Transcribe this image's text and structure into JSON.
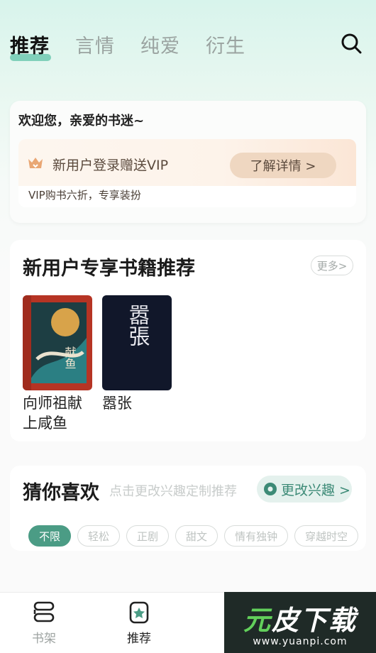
{
  "top_tabs": [
    {
      "label": "推荐",
      "active": true
    },
    {
      "label": "言情",
      "active": false
    },
    {
      "label": "纯爱",
      "active": false
    },
    {
      "label": "衍生",
      "active": false
    }
  ],
  "welcome": {
    "title": "欢迎您，亲爱的书迷~",
    "vip_text": "新用户登录赠送VIP",
    "vip_button": "了解详情 >",
    "vip_sub": "VIP购书六折，专享装扮"
  },
  "new_user_books": {
    "title": "新用户专享书籍推荐",
    "more": "更多>",
    "books": [
      {
        "title": "向师祖献上咸鱼",
        "cover_text": "献鱼"
      },
      {
        "title": "嚣张",
        "cover_text": "嚣張"
      }
    ]
  },
  "guess": {
    "title": "猜你喜欢",
    "hint": "点击更改兴趣定制推荐",
    "interest_button": "更改兴趣 >",
    "chips": [
      "不限",
      "轻松",
      "正剧",
      "甜文",
      "情有独钟",
      "穿越时空"
    ]
  },
  "bottom_nav": [
    {
      "label": "书架",
      "active": false
    },
    {
      "label": "推荐",
      "active": true
    }
  ],
  "watermark": {
    "title_a": "元",
    "title_b": "皮",
    "title_c": "下载",
    "url": "www.yuanpi.com"
  },
  "colors": {
    "accent": "#4b9c85",
    "vip_brown": "#5b4a3d"
  }
}
